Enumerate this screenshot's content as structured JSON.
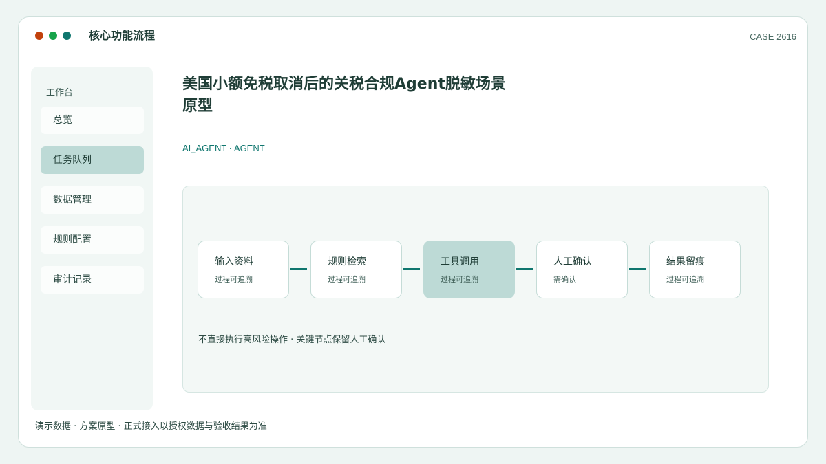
{
  "window": {
    "title": "核心功能流程",
    "case_id": "CASE 2616",
    "traffic_colors": [
      "#c2410c",
      "#16a34a",
      "#0f766e"
    ]
  },
  "sidebar": {
    "heading": "工作台",
    "items": [
      {
        "label": "总览",
        "active": false
      },
      {
        "label": "任务队列",
        "active": true
      },
      {
        "label": "数据管理",
        "active": false
      },
      {
        "label": "规则配置",
        "active": false
      },
      {
        "label": "审计记录",
        "active": false
      }
    ]
  },
  "main": {
    "title": "美国小额免税取消后的关税合规Agent脱敏场景原型",
    "tags": "AI_AGENT · AGENT"
  },
  "flow": {
    "steps": [
      {
        "title": "输入资料",
        "subtitle": "过程可追溯",
        "active": false
      },
      {
        "title": "规则检索",
        "subtitle": "过程可追溯",
        "active": false
      },
      {
        "title": "工具调用",
        "subtitle": "过程可追溯",
        "active": true
      },
      {
        "title": "人工确认",
        "subtitle": "需确认",
        "active": false
      },
      {
        "title": "结果留痕",
        "subtitle": "过程可追溯",
        "active": false
      }
    ],
    "note": "不直接执行高风险操作 · 关键节点保留人工确认"
  },
  "footer": {
    "note": "演示数据 · 方案原型 · 正式接入以授权数据与验收结果为准"
  },
  "colors": {
    "accent": "#0f766e",
    "active_fill": "#bddad6",
    "background": "#eef5f3"
  }
}
